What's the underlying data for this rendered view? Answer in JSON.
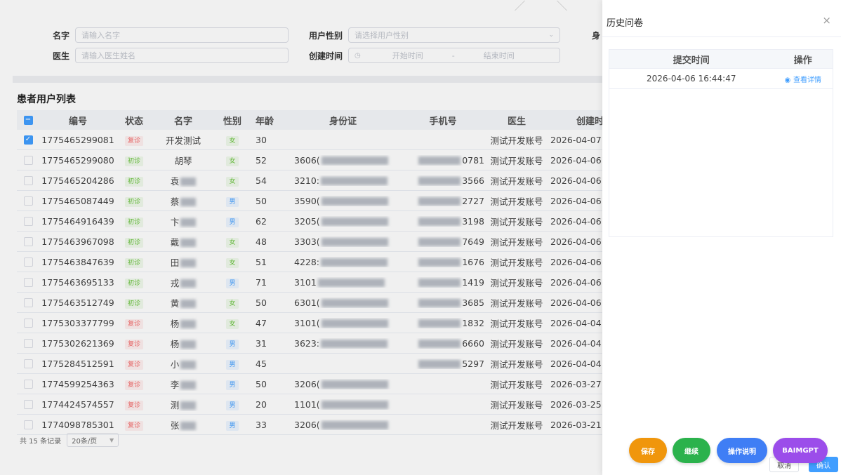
{
  "filters": {
    "name_label": "名字",
    "name_placeholder": "请输入名字",
    "doctor_label": "医生",
    "doctor_placeholder": "请输入医生姓名",
    "gender_label": "用户性别",
    "gender_placeholder": "请选择用户性别",
    "created_label": "创建时间",
    "start_placeholder": "开始时间",
    "range_separator": "-",
    "end_placeholder": "结束时间",
    "extra_label_partial": "身"
  },
  "list": {
    "title": "患者用户列表",
    "columns": [
      "编号",
      "状态",
      "名字",
      "性别",
      "年龄",
      "身份证",
      "手机号",
      "医生",
      "创建时"
    ],
    "rows": [
      {
        "checked": true,
        "id": "1775465299081",
        "status": "复诊",
        "status_type": "red",
        "name": "开发测试",
        "gender": "女",
        "age": "30",
        "idcard": "",
        "phone": "",
        "doctor": "测试开发账号",
        "created": "2026-04-07"
      },
      {
        "checked": false,
        "id": "1775465299080",
        "status": "初诊",
        "status_type": "green",
        "name": "胡琴",
        "gender": "女",
        "age": "52",
        "idcard": "3606(",
        "phone": "0781",
        "doctor": "测试开发账号",
        "created": "2026-04-06"
      },
      {
        "checked": false,
        "id": "1775465204286",
        "status": "初诊",
        "status_type": "green",
        "name": "袁",
        "gender": "女",
        "age": "54",
        "idcard": "3210:",
        "phone": "3566",
        "doctor": "测试开发账号",
        "created": "2026-04-06"
      },
      {
        "checked": false,
        "id": "1775465087449",
        "status": "初诊",
        "status_type": "green",
        "name": "蔡",
        "gender": "男",
        "age": "50",
        "idcard": "3590(",
        "phone": "2727",
        "doctor": "测试开发账号",
        "created": "2026-04-06"
      },
      {
        "checked": false,
        "id": "1775464916439",
        "status": "初诊",
        "status_type": "green",
        "name": "卞",
        "gender": "男",
        "age": "62",
        "idcard": "3205(",
        "phone": "3198",
        "doctor": "测试开发账号",
        "created": "2026-04-06"
      },
      {
        "checked": false,
        "id": "1775463967098",
        "status": "初诊",
        "status_type": "green",
        "name": "戴",
        "gender": "女",
        "age": "48",
        "idcard": "3303(",
        "phone": "7649",
        "doctor": "测试开发账号",
        "created": "2026-04-06"
      },
      {
        "checked": false,
        "id": "1775463847639",
        "status": "初诊",
        "status_type": "green",
        "name": "田",
        "gender": "女",
        "age": "51",
        "idcard": "4228:",
        "phone": "1676",
        "doctor": "测试开发账号",
        "created": "2026-04-06"
      },
      {
        "checked": false,
        "id": "1775463695133",
        "status": "初诊",
        "status_type": "green",
        "name": "戎",
        "gender": "男",
        "age": "71",
        "idcard": "3101",
        "phone": "1419",
        "doctor": "测试开发账号",
        "created": "2026-04-06"
      },
      {
        "checked": false,
        "id": "1775463512749",
        "status": "初诊",
        "status_type": "green",
        "name": "黄",
        "gender": "女",
        "age": "50",
        "idcard": "6301(",
        "phone": "3685",
        "doctor": "测试开发账号",
        "created": "2026-04-06"
      },
      {
        "checked": false,
        "id": "1775303377799",
        "status": "复诊",
        "status_type": "red",
        "name": "杨",
        "gender": "女",
        "age": "47",
        "idcard": "3101(",
        "phone": "1832",
        "doctor": "测试开发账号",
        "created": "2026-04-04"
      },
      {
        "checked": false,
        "id": "1775302621369",
        "status": "复诊",
        "status_type": "red",
        "name": "杨",
        "gender": "男",
        "age": "31",
        "idcard": "3623:",
        "phone": "6660",
        "doctor": "测试开发账号",
        "created": "2026-04-04"
      },
      {
        "checked": false,
        "id": "1775284512591",
        "status": "复诊",
        "status_type": "red",
        "name": "小",
        "gender": "男",
        "age": "45",
        "idcard": "",
        "phone": "5297",
        "doctor": "测试开发账号",
        "created": "2026-04-04"
      },
      {
        "checked": false,
        "id": "1774599254363",
        "status": "复诊",
        "status_type": "red",
        "name": "李",
        "gender": "男",
        "age": "50",
        "idcard": "3206(",
        "phone": "",
        "doctor": "测试开发账号",
        "created": "2026-03-27"
      },
      {
        "checked": false,
        "id": "1774424574557",
        "status": "复诊",
        "status_type": "red",
        "name": "测",
        "gender": "男",
        "age": "20",
        "idcard": "1101(",
        "phone": "",
        "doctor": "测试开发账号",
        "created": "2026-03-25"
      },
      {
        "checked": false,
        "id": "1774098785301",
        "status": "复诊",
        "status_type": "red",
        "name": "张",
        "gender": "男",
        "age": "33",
        "idcard": "3206(",
        "phone": "",
        "doctor": "测试开发账号",
        "created": "2026-03-21"
      }
    ]
  },
  "pager": {
    "total": "共 15 条记录",
    "page_size": "20条/页"
  },
  "drawer": {
    "title": "历史问卷",
    "close": "×",
    "col_time": "提交时间",
    "col_action": "操作",
    "rows": [
      {
        "time": "2026-04-06 16:44:47",
        "action": "查看详情"
      }
    ]
  },
  "fabs": {
    "save": "保存",
    "continue": "继续",
    "help": "操作说明",
    "gpt": "BAIMGPT"
  },
  "footer": {
    "cancel": "取消",
    "confirm": "确认"
  },
  "colors": {
    "primary": "#409eff",
    "save": "#f0960c",
    "continue": "#2bb24c",
    "help": "#3f7ef5",
    "gpt": "#9b4dea"
  }
}
